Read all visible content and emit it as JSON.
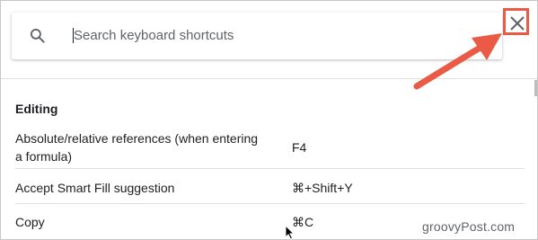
{
  "search": {
    "placeholder": "Search keyboard shortcuts",
    "value": ""
  },
  "icons": {
    "search": "search-icon",
    "close": "close-icon",
    "annotation_arrow": "arrow-icon",
    "cursor": "mouse-cursor-icon"
  },
  "section": {
    "title": "Editing"
  },
  "shortcuts": [
    {
      "description": "Absolute/relative references (when entering a formula)",
      "keys": "F4"
    },
    {
      "description": "Accept Smart Fill suggestion",
      "keys": "⌘+Shift+Y"
    },
    {
      "description": "Copy",
      "keys": "⌘C"
    }
  ],
  "watermark": "groovyPost.com",
  "colors": {
    "annotation": "#ea5a45",
    "text": "#202124",
    "icon": "#5f6368",
    "divider": "#e0e0e0"
  }
}
